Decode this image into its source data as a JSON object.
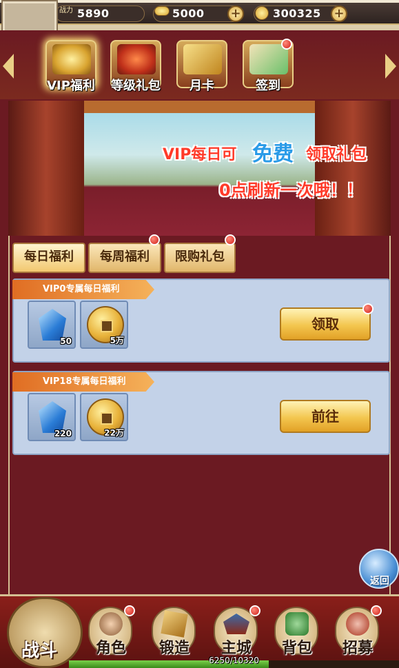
{
  "header": {
    "power_label": "战力",
    "power_value": "5890",
    "gold_value": "5000",
    "coin_value": "300325",
    "plus_symbol": "+"
  },
  "tabs": [
    {
      "label": "VIP福利",
      "icon": "vip-gold-icon",
      "active": true
    },
    {
      "label": "等级礼包",
      "icon": "level-gift-icon",
      "badge": false
    },
    {
      "label": "月卡",
      "icon": "month-card-icon",
      "badge": false
    },
    {
      "label": "签到",
      "icon": "sign-in-scroll-icon",
      "badge": true
    }
  ],
  "banner": {
    "line1_a": "VIP每日可",
    "line1_b": "免费",
    "line1_c": "领取礼包",
    "line2": "0点刷新一次哦！！"
  },
  "subtabs": [
    {
      "label": "每日福利",
      "active": true,
      "badge": false
    },
    {
      "label": "每周福利",
      "active": false,
      "badge": true
    },
    {
      "label": "限购礼包",
      "active": false,
      "badge": true
    }
  ],
  "cards": [
    {
      "title": "VIP0专属每日福利",
      "items": [
        {
          "icon": "blue-gem-icon",
          "qty": "50"
        },
        {
          "icon": "gold-coin-icon",
          "qty": "5万"
        }
      ],
      "button": "领取",
      "button_badge": true
    },
    {
      "title": "VIP18专属每日福利",
      "items": [
        {
          "icon": "blue-gem-icon",
          "qty": "220"
        },
        {
          "icon": "gold-coin-icon",
          "qty": "22万"
        }
      ],
      "button": "前往",
      "button_badge": false
    }
  ],
  "back_label": "返回",
  "nav": {
    "battle": "战斗",
    "items": [
      {
        "label": "角色",
        "icon": "character-icon",
        "badge": true
      },
      {
        "label": "锻造",
        "icon": "forge-icon",
        "badge": false
      },
      {
        "label": "主城",
        "icon": "main-city-icon",
        "badge": true
      },
      {
        "label": "背包",
        "icon": "bag-icon",
        "badge": false
      },
      {
        "label": "招募",
        "icon": "recruit-icon",
        "badge": true
      }
    ]
  },
  "exp": {
    "text": "6250/10320",
    "current": 6250,
    "max": 10320
  },
  "colors": {
    "accent_red": "#d0201a",
    "button_gold": "#f3c64f",
    "panel_blue": "#c3d2e8"
  }
}
